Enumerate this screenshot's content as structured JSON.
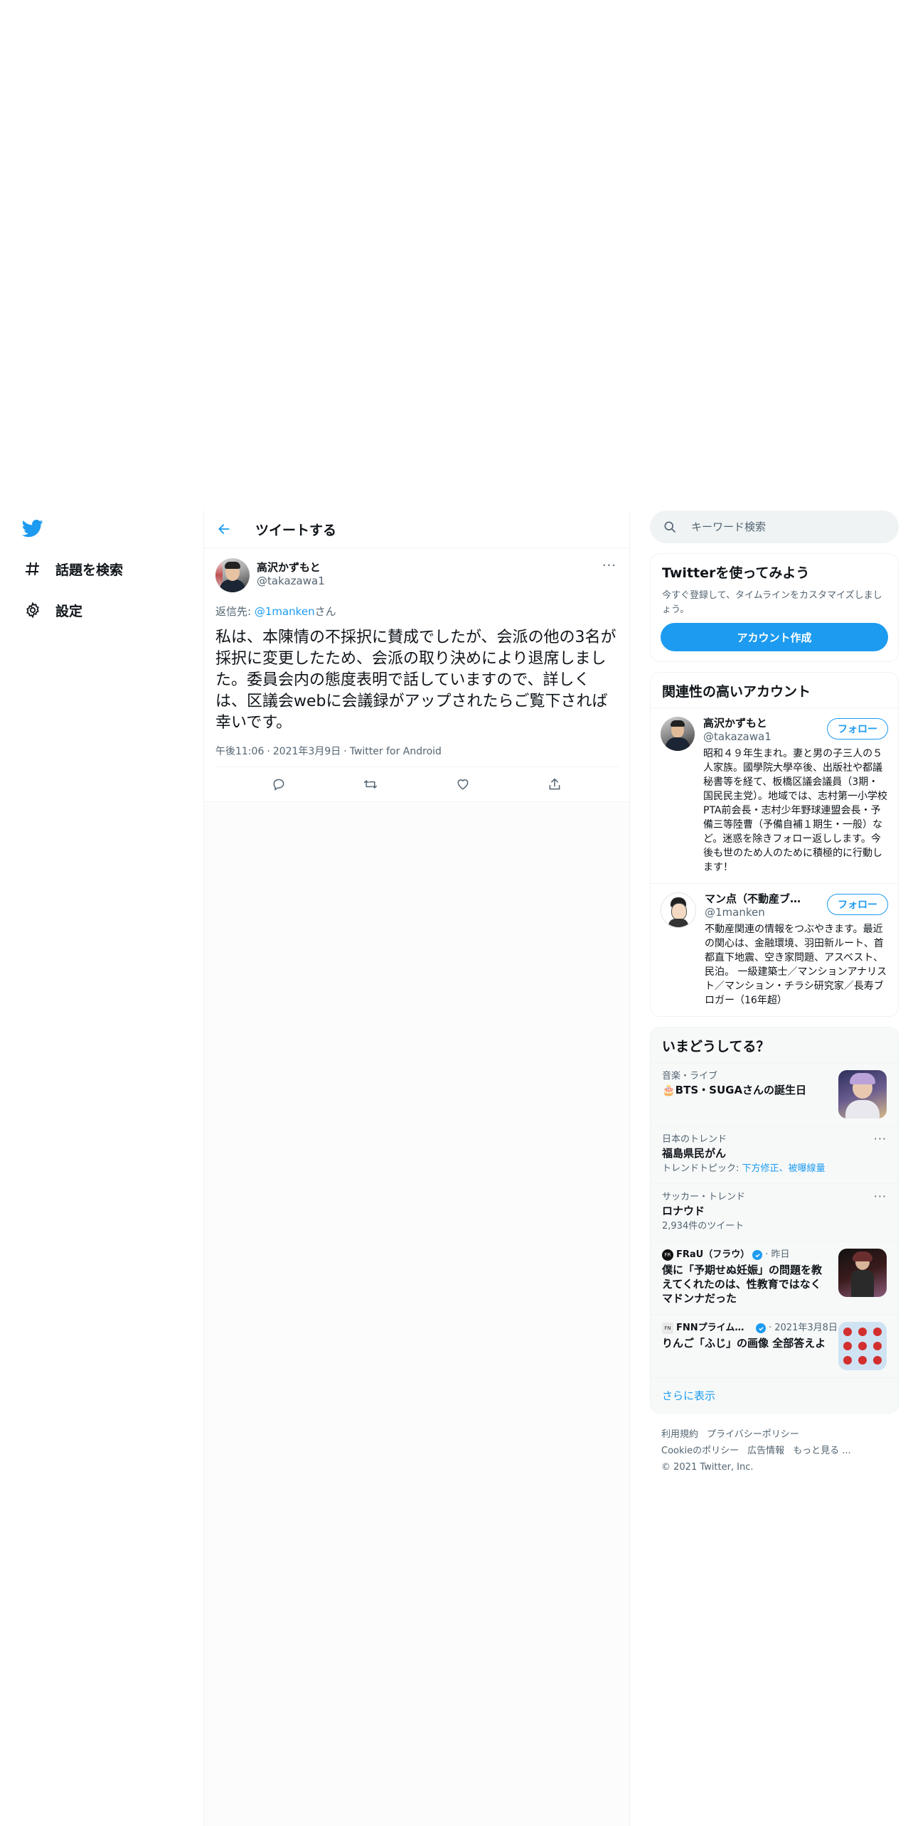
{
  "nav": {
    "items": [
      {
        "label": "話題を検索",
        "icon": "hashtag-icon"
      },
      {
        "label": "設定",
        "icon": "gear-icon"
      }
    ]
  },
  "main": {
    "header_title": "ツイートする",
    "tweet": {
      "author_name": "高沢かずもと",
      "author_handle": "@takazawa1",
      "reply_prefix": "返信先: ",
      "reply_mention": "@1manken",
      "reply_suffix": "さん",
      "text": "私は、本陳情の不採択に賛成でしたが、会派の他の3名が採択に変更したため、会派の取り決めにより退席しました。委員会内の態度表明で話していますので、詳しくは、区議会webに会議録がアップされたらご覧下されば幸いです。",
      "time": "午後11:06",
      "date": "2021年3月9日",
      "source": "Twitter for Android",
      "separator": "·"
    }
  },
  "sidebar": {
    "search_placeholder": "キーワード検索",
    "signup": {
      "title": "Twitterを使ってみよう",
      "desc": "今すぐ登録して、タイムラインをカスタマイズしましょう。",
      "button": "アカウント作成"
    },
    "related": {
      "title": "関連性の高いアカウント",
      "follow_label": "フォロー",
      "accounts": [
        {
          "name": "高沢かずもと",
          "handle": "@takazawa1",
          "bio": "昭和４９年生まれ。妻と男の子三人の５人家族。國學院大學卒後、出版社や都議秘書等を経て、板橋区議会議員（3期・国民民主党）。地域では、志村第一小学校PTA前会長・志村少年野球連盟会長・予備三等陸曹（予備自補１期生・一般）など。迷惑を除きフォロー返しします。今後も世のため人のために積極的に行動します！"
        },
        {
          "name": "マン点（不動産ブロガー）",
          "handle": "@1manken",
          "bio": "不動産関連の情報をつぶやきます。最近の関心は、金融環境、羽田新ルート、首都直下地震、空き家問題、アスベスト、民泊。 一級建築士／マンションアナリスト／マンション・チラシ研究家／長寿ブロガー（16年超）"
        }
      ]
    },
    "trends": {
      "title": "いまどうしてる？",
      "items": [
        {
          "context": "音楽・ライブ",
          "title": "🎂BTS・SUGAさんの誕生日"
        },
        {
          "context": "日本のトレンド",
          "title": "福島県民がん",
          "sub_prefix": "トレンドトピック: ",
          "sub_links": "下方修正、被曝線量"
        },
        {
          "context": "サッカー・トレンド",
          "title": "ロナウド",
          "sub": "2,934件のツイート"
        }
      ],
      "news": [
        {
          "source": "FRaU（フラウ）",
          "time": "· 昨日",
          "title": "僕に「予期せぬ妊娠」の問題を教えてくれたのは、性教育ではなくマドンナだった"
        },
        {
          "source": "FNNプライムオンライン",
          "time": "· 2021年3月8日",
          "title": "りんご「ふじ」の画像 全部答えよ"
        }
      ],
      "show_more": "さらに表示"
    },
    "footer": {
      "links_row1": [
        "利用規約",
        "プライバシーポリシー"
      ],
      "links_row2": [
        "Cookieのポリシー",
        "広告情報",
        "もっと見る ..."
      ],
      "copyright": "© 2021 Twitter, Inc."
    }
  },
  "colors": {
    "accent": "#1d9bf0",
    "text": "#0f1419",
    "muted": "#536471",
    "border": "#eff3f4"
  }
}
